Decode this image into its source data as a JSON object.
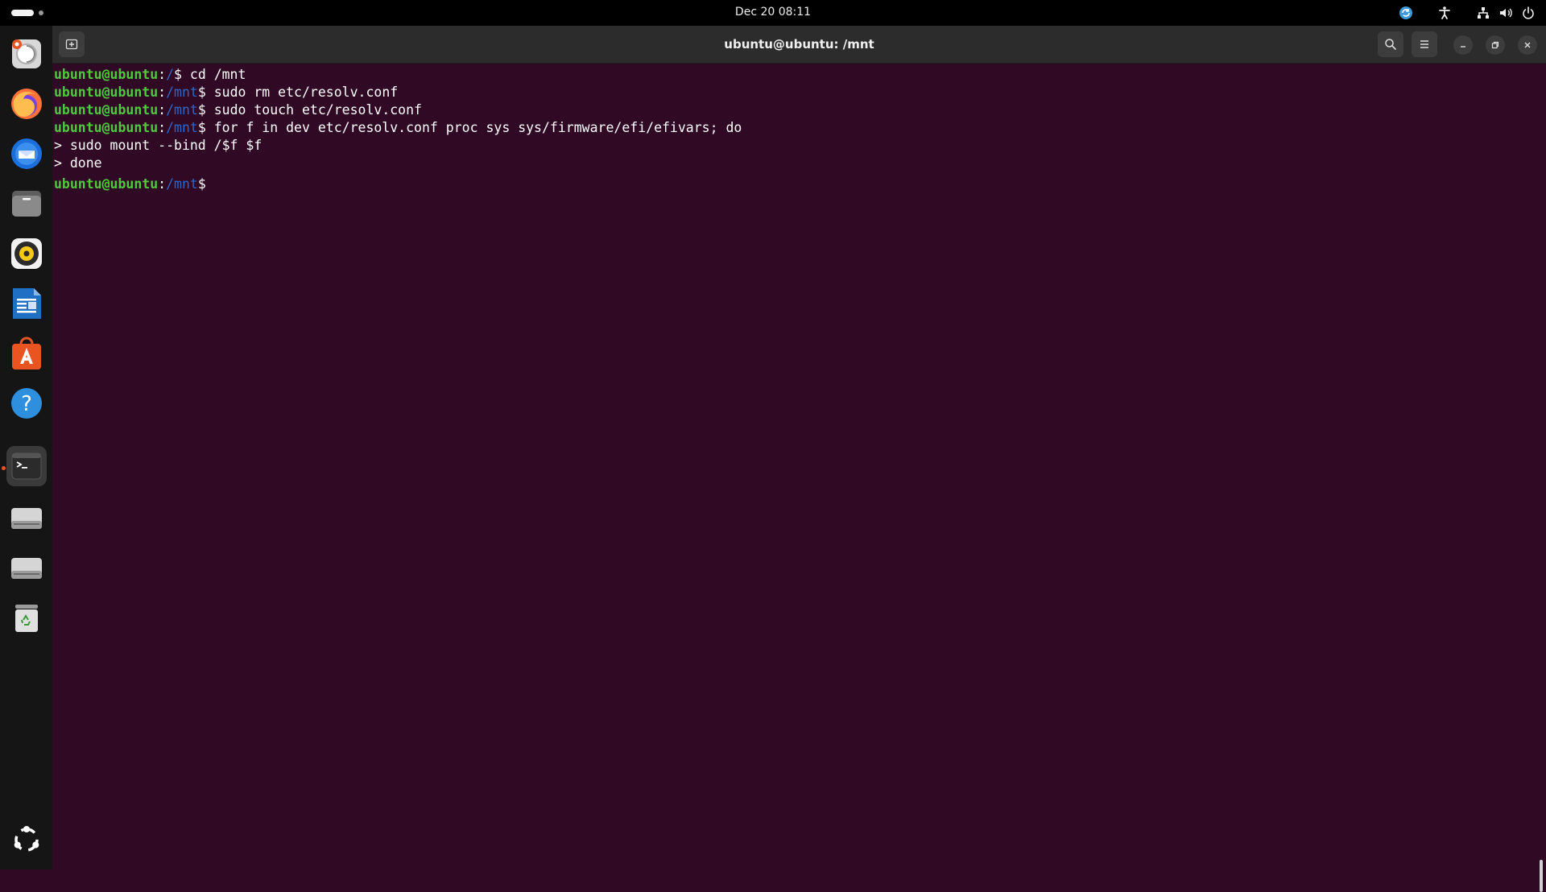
{
  "topbar": {
    "clock": "Dec 20  08:11"
  },
  "window": {
    "title": "ubuntu@ubuntu: /mnt"
  },
  "terminal": {
    "lines": [
      {
        "user": "ubuntu@ubuntu",
        "sep": ":",
        "path": "/",
        "dollar": "$ ",
        "cmd": "cd /mnt"
      },
      {
        "user": "ubuntu@ubuntu",
        "sep": ":",
        "path": "/mnt",
        "dollar": "$ ",
        "cmd": "sudo rm etc/resolv.conf"
      },
      {
        "user": "ubuntu@ubuntu",
        "sep": ":",
        "path": "/mnt",
        "dollar": "$ ",
        "cmd": "sudo touch etc/resolv.conf"
      },
      {
        "user": "ubuntu@ubuntu",
        "sep": ":",
        "path": "/mnt",
        "dollar": "$ ",
        "cmd": "for f in dev etc/resolv.conf proc sys sys/firmware/efi/efivars; do"
      },
      {
        "text": "> sudo mount --bind /$f $f"
      },
      {
        "text": "> done"
      },
      {
        "user": "ubuntu@ubuntu",
        "sep": ":",
        "path": "/mnt",
        "dollar": "$",
        "cmd": ""
      }
    ]
  },
  "dock": {
    "items": [
      "ubuntu-installer-icon",
      "firefox-icon",
      "thunderbird-icon",
      "files-icon",
      "rhythmbox-icon",
      "libreoffice-writer-icon",
      "app-center-icon",
      "help-icon",
      "terminal-icon",
      "drive-icon",
      "drive-icon",
      "trash-icon",
      "show-apps-icon"
    ]
  },
  "colors": {
    "terminal_bg": "#300a24",
    "prompt_user": "#4ec940",
    "prompt_path": "#2f66c8",
    "accent": "#e95420"
  }
}
